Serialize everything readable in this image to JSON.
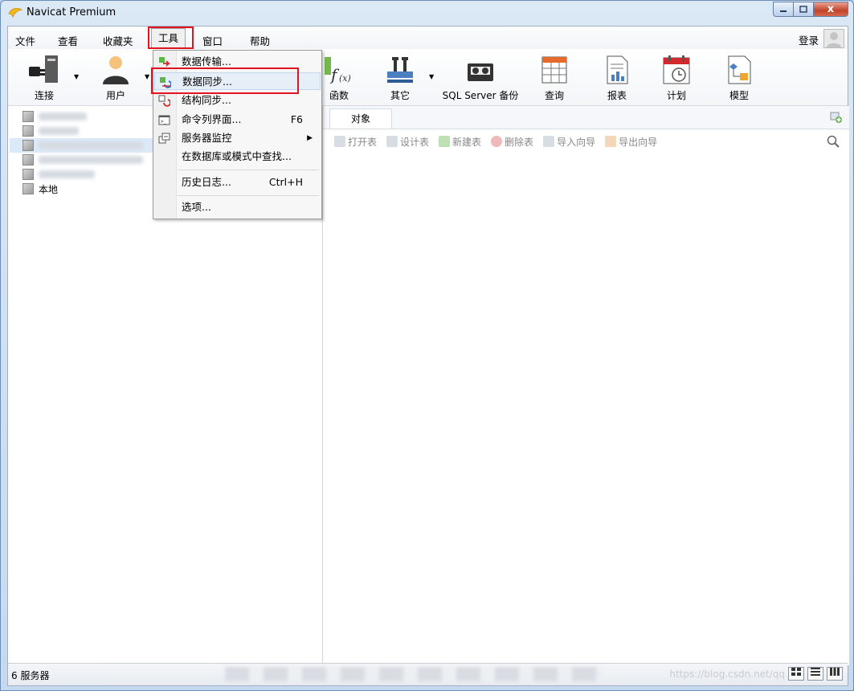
{
  "window": {
    "title": "Navicat Premium",
    "close_label": "x"
  },
  "menubar": {
    "items": [
      "文件",
      "查看",
      "收藏夹",
      "工具",
      "窗口",
      "帮助"
    ],
    "login": "登录"
  },
  "toolbar": {
    "connect": "连接",
    "user": "用户",
    "function": "函数",
    "other": "其它",
    "sqlserver_backup": "SQL Server 备份",
    "query": "查询",
    "report": "报表",
    "schedule": "计划",
    "model": "模型"
  },
  "tools_menu": {
    "items": [
      {
        "label": "数据传输...",
        "shortcut": ""
      },
      {
        "label": "数据同步...",
        "shortcut": ""
      },
      {
        "label": "结构同步...",
        "shortcut": ""
      },
      {
        "label": "命令列界面...",
        "shortcut": "F6"
      },
      {
        "label": "服务器监控",
        "shortcut": ""
      },
      {
        "label": "在数据库或模式中查找...",
        "shortcut": ""
      },
      {
        "label": "历史日志...",
        "shortcut": "Ctrl+H"
      },
      {
        "label": "选项...",
        "shortcut": ""
      }
    ]
  },
  "tree": {
    "local_label": "本地"
  },
  "objects": {
    "tab_label": "对象",
    "actions": [
      "打开表",
      "设计表",
      "新建表",
      "删除表",
      "导入向导",
      "导出向导"
    ]
  },
  "statusbar": {
    "server_count": "6 服务器",
    "watermark": "https://blog.csdn.net/qq"
  },
  "colors": {
    "highlight_red": "#e0141e",
    "menu_hover": "#e6eef8"
  }
}
